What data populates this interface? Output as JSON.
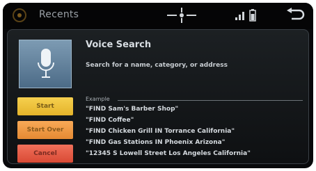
{
  "header": {
    "title": "Recents",
    "home_icon": "home-icon",
    "compass_icon": "compass-icon",
    "signal_icon": "signal-bars-icon",
    "battery_icon": "battery-icon",
    "back_icon": "back-arrow-icon"
  },
  "voice": {
    "heading": "Voice Search",
    "subheading": "Search for a name, category, or address",
    "mic_icon": "microphone-icon"
  },
  "buttons": [
    {
      "label": "Start",
      "color": "#f2c63f"
    },
    {
      "label": "Start Over",
      "color": "#f09c4a"
    },
    {
      "label": "Cancel",
      "color": "#e65d47"
    }
  ],
  "examples": {
    "label": "Example",
    "items": [
      "\"FIND Sam's Barber Shop\"",
      "\"FIND Coffee\"",
      "\"FIND Chicken Grill IN Torrance California\"",
      "\"FIND Gas Stations IN Phoenix Arizona\"",
      "\"12345 S Lowell Street Los Angeles California\""
    ]
  }
}
